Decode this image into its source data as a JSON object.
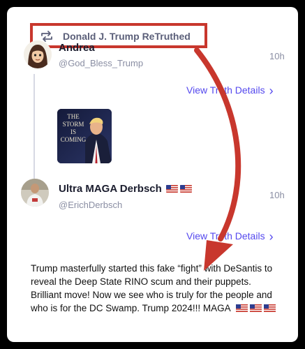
{
  "retruth": {
    "label": "Donald J. Trump ReTruthed",
    "icon": "retruth-icon",
    "highlight_color": "#c8372d"
  },
  "posts": [
    {
      "name": "Andrea",
      "handle": "@God_Bless_Trump",
      "time": "10h",
      "view_details": "View Truth Details",
      "image_caption": "THE\nSTORM\nIS\nCOMING"
    },
    {
      "name": "Ultra MAGA Derbsch",
      "handle": "@ErichDerbsch",
      "time": "10h",
      "view_details": "View Truth Details",
      "body": "Trump masterfully started this fake “fight” with DeSantis to reveal the Deep State RINO scum and their puppets. Brilliant move! Now we see who is truly for the people and who is for the DC Swamp. Trump 2024!!! MAGA"
    }
  ],
  "colors": {
    "accent": "#5448ee",
    "annotation_red": "#c8372d",
    "muted_text": "#8a8ea3"
  }
}
